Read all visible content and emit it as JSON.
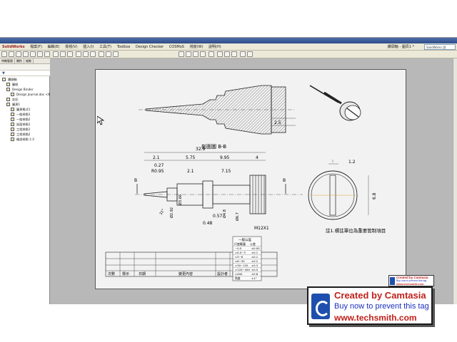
{
  "app": {
    "brand": "SolidWorks",
    "menu": [
      "檔案(F)",
      "編輯(E)",
      "檢視(V)",
      "插入(I)",
      "工具(T)",
      "Toolbox",
      "Design Checker",
      "COSMoS",
      "視窗(W)",
      "說明(H)"
    ],
    "document_title": "鑽頭軸 - 圖頁1 *",
    "search_placeholder": "SolidWorks 說"
  },
  "sidebar": {
    "tabs": [
      "特徵管理",
      "屬性",
      "組態"
    ],
    "filter_icon": "filter-icon",
    "tree": [
      {
        "label": "鑽頭軸",
        "icon": "drawing-icon",
        "indent": 0
      },
      {
        "label": "圖紙",
        "icon": "folder-icon",
        "indent": 1
      },
      {
        "label": "Design Binder",
        "icon": "binder-icon",
        "indent": 1
      },
      {
        "label": "Design Journal.doc <預設>",
        "icon": "document-icon",
        "indent": 2
      },
      {
        "label": "註記",
        "icon": "annotation-icon",
        "indent": 1
      },
      {
        "label": "圖頁1",
        "icon": "sheet-icon",
        "indent": 1
      },
      {
        "label": "圖頁格式1",
        "icon": "sheet-format-icon",
        "indent": 2
      },
      {
        "label": "一般視角1",
        "icon": "view-icon",
        "indent": 2
      },
      {
        "label": "一般視角2",
        "icon": "view-icon",
        "indent": 2
      },
      {
        "label": "剖面視角1",
        "icon": "section-view-icon",
        "indent": 2
      },
      {
        "label": "工程視角1",
        "icon": "view-icon",
        "indent": 2
      },
      {
        "label": "工程視角2",
        "icon": "view-icon",
        "indent": 2
      },
      {
        "label": "細部視角 1:3",
        "icon": "detail-view-icon",
        "indent": 2
      }
    ]
  },
  "drawing": {
    "section_label": "剖面圖 B-B",
    "section_dim": "2.5",
    "dims": {
      "overall": "32.9",
      "d1": "2.1",
      "d2": "5.75",
      "d3": "9.95",
      "d4": "4",
      "d5": "0.27",
      "d6": "R0.95",
      "d7": "2.1",
      "d8": "7.15",
      "d9": "0.48",
      "d10": "0.57",
      "phi1": "Ø3.66",
      "phi2": "Ø2.92",
      "phi3": "Ø4.8",
      "phi4": "Ø6.7",
      "angle": "31°",
      "thread": "M12X1",
      "side_top": "1.2",
      "side_right": "6.8",
      "cut_b": "B"
    },
    "note": "註1.標註單位為重要管制項目",
    "tolerance_table": {
      "title": "一般公差",
      "headers": [
        "尺度範圍",
        "公差"
      ],
      "rows": [
        [
          "~0.5",
          "±0.05"
        ],
        [
          ">0.5~3",
          "±0.1"
        ],
        [
          ">3~6",
          "±0.1"
        ],
        [
          ">6~30",
          "±0.2"
        ],
        [
          ">30~120",
          "±0.3"
        ],
        [
          ">120~400",
          "±0.5"
        ],
        [
          ">400",
          "±0.8"
        ],
        [
          "角度",
          "±1°"
        ]
      ]
    },
    "revision_headers": [
      "次數",
      "標示",
      "日期",
      "變更內容",
      "設計者",
      "核准"
    ]
  },
  "watermark": {
    "line1": "Created by Camtasia",
    "line2": "Buy now to prevent this tag",
    "line3": "www.techsmith.com",
    "mini_line1": "Created by Camtasia",
    "mini_line2": "Buy now to prevent this tag",
    "mini_line3": "www.techsmith.com"
  },
  "colors": {
    "titlebar": "#2f4e8a",
    "chrome": "#ece9d8",
    "sheet": "#f2f2f2",
    "canvas": "#b8b8b8",
    "watermark_red": "#c0201a",
    "watermark_blue": "#1a2fbe"
  }
}
